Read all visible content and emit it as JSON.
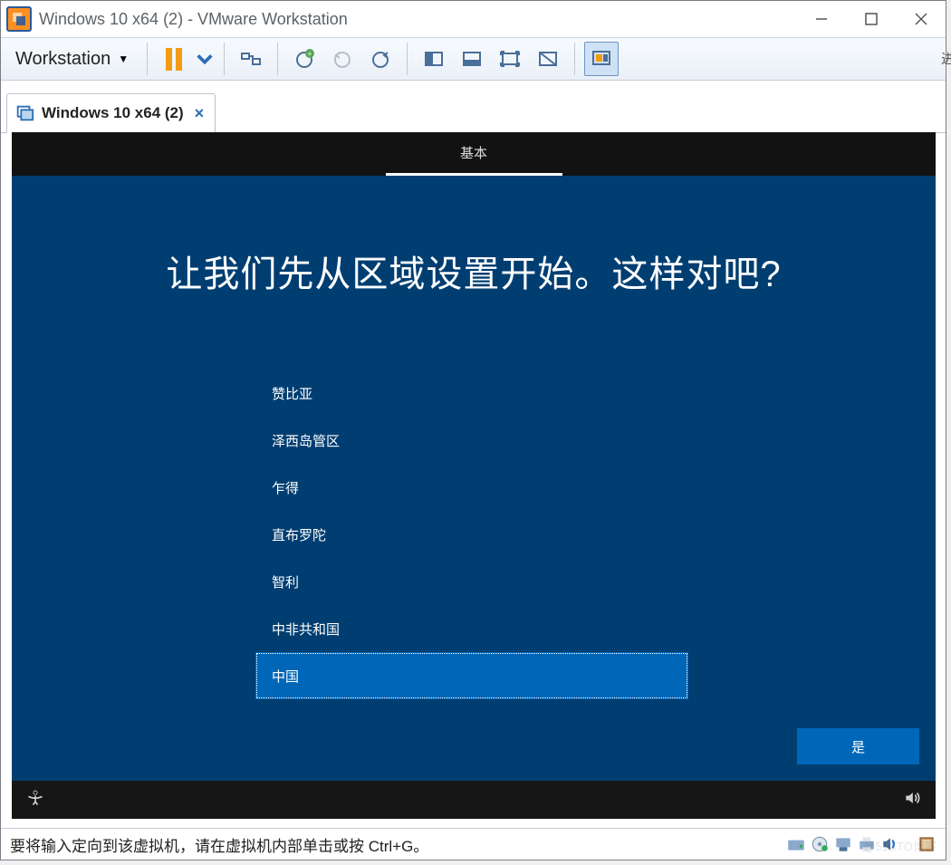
{
  "window": {
    "title": "Windows 10 x64 (2) - VMware Workstation",
    "menu_label": "Workstation",
    "tab_label": "Windows 10 x64 (2)"
  },
  "toolbar_icons": {
    "pause": "pause",
    "pause_more": "dropdown",
    "devices": "devices",
    "snapshot_take": "snapshot-take",
    "snapshot_revert": "snapshot-revert",
    "snapshot_manage": "snapshot-manage",
    "fit": "fit-guest",
    "fullscreen": "fullscreen",
    "unity": "unity",
    "stretch": "stretch",
    "thumbnail": "thumbnail-bar"
  },
  "oobe": {
    "tab": "基本",
    "heading": "让我们先从区域设置开始。这样对吧?",
    "regions": [
      "赞比亚",
      "泽西岛管区",
      "乍得",
      "直布罗陀",
      "智利",
      "中非共和国",
      "中国"
    ],
    "selected_index": 6,
    "yes_label": "是"
  },
  "statusbar": {
    "hint": "要将输入定向到该虚拟机，请在虚拟机内部单击或按 Ctrl+G。"
  },
  "edge_text_top": "进",
  "watermark": "@51CTO博客"
}
